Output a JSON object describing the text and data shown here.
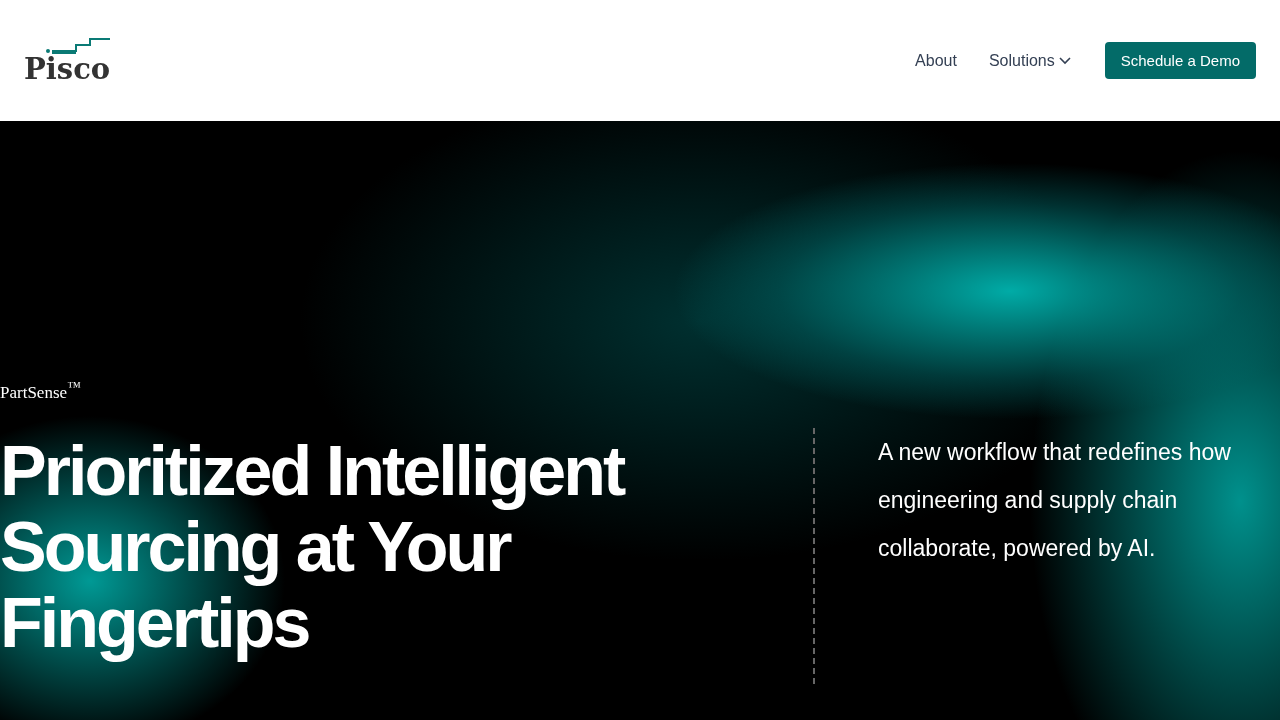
{
  "header": {
    "logo": "Pisco",
    "nav": [
      {
        "label": "About",
        "kind": "link"
      },
      {
        "label": "Solutions",
        "kind": "dropdown"
      }
    ],
    "cta": "Schedule a Demo"
  },
  "hero": {
    "eyebrow": "PartSense$^{™}$",
    "headline_lines": [
      "Prioritized Intelligent",
      "Sourcing at Your",
      "Fingertips"
    ],
    "description": "A new workflow that redefines how engineering and supply chain collaborate, powered by AI."
  }
}
